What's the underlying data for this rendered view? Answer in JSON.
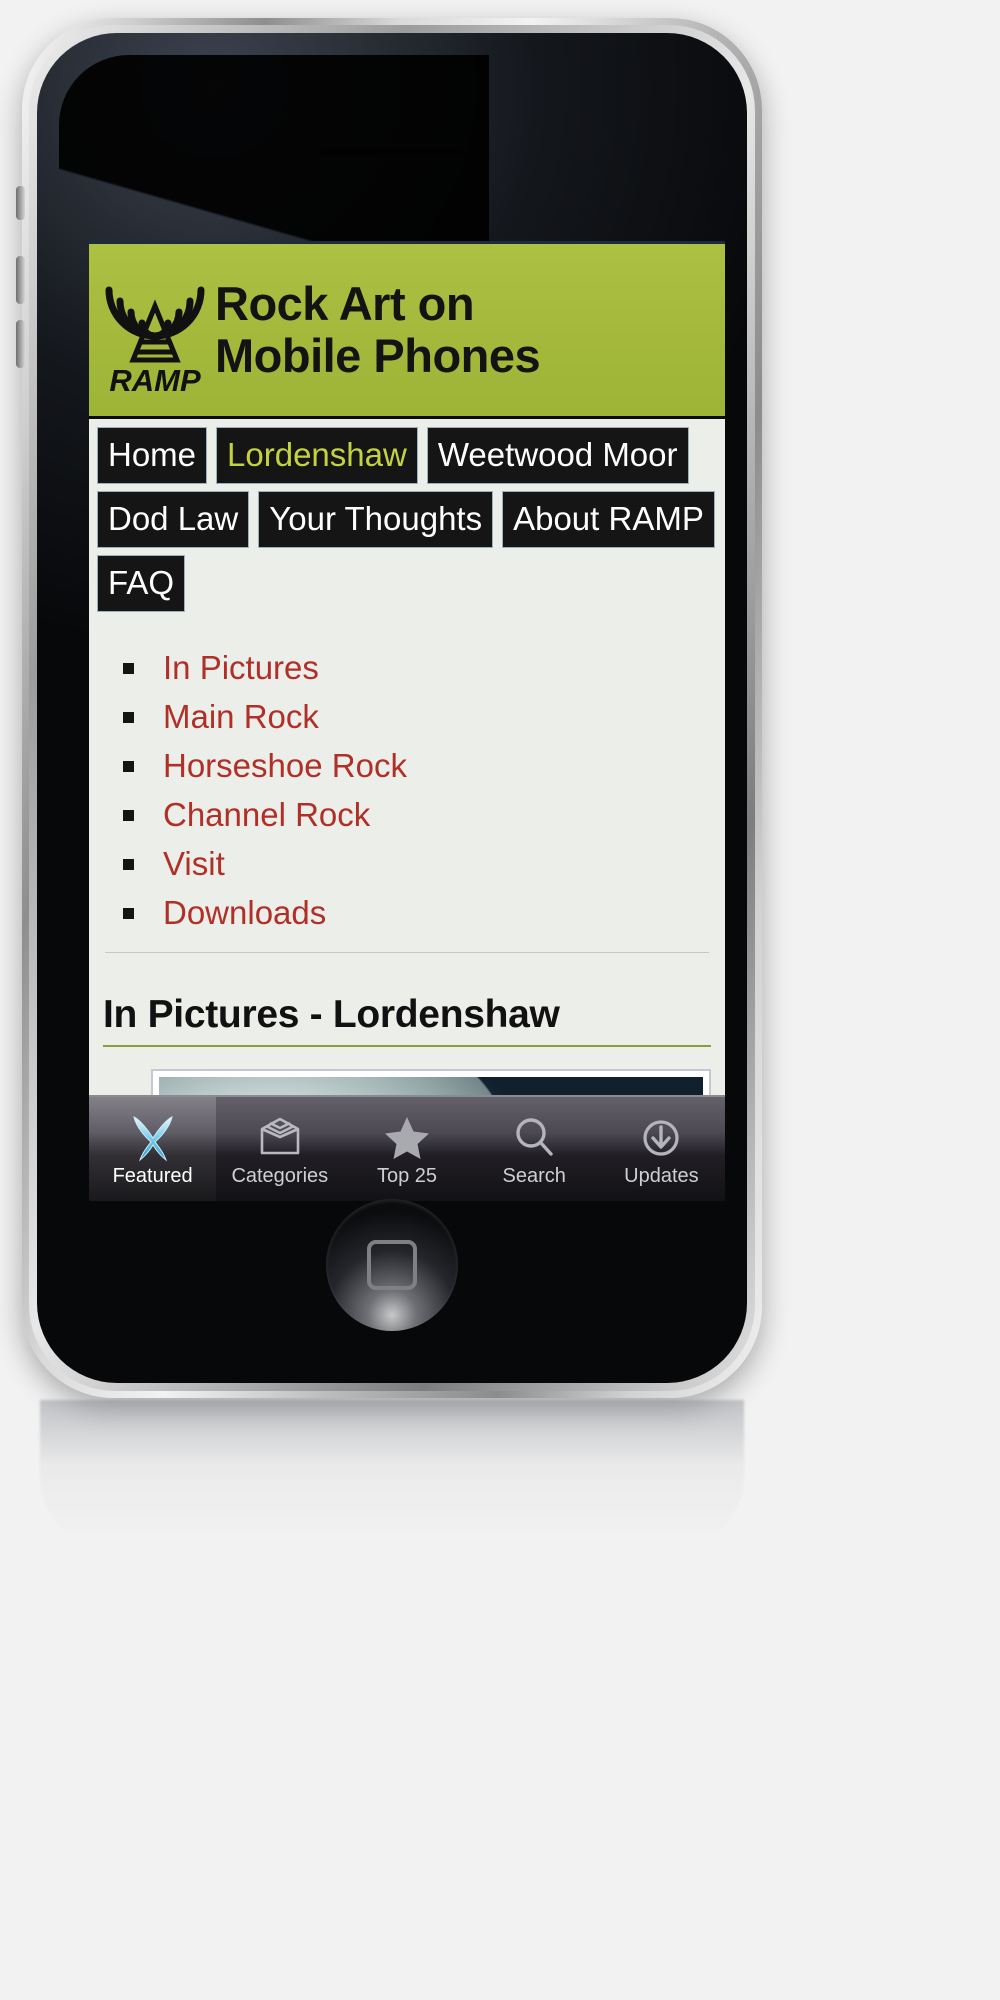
{
  "device": {
    "name": "iphone-3gs",
    "home_button": "home-button",
    "earpiece": "earpiece-speaker"
  },
  "site": {
    "header": {
      "logo_text": "RAMP",
      "logo_icon": "radio-tower-icon",
      "title_line1": "Rock Art on",
      "title_line2": "Mobile Phones",
      "background_color": "#a4b93c"
    },
    "nav": {
      "rows": [
        [
          {
            "label": "Home",
            "active": false
          },
          {
            "label": "Lordenshaw",
            "active": true
          },
          {
            "label": "Weetwood Moor",
            "active": false
          }
        ],
        [
          {
            "label": "Dod Law",
            "active": false
          },
          {
            "label": "Your Thoughts",
            "active": false
          },
          {
            "label": "About RAMP",
            "active": false
          }
        ],
        [
          {
            "label": "FAQ",
            "active": false
          }
        ]
      ],
      "active_color": "#c3d23f",
      "button_bg": "#151515"
    },
    "sublinks": [
      {
        "label": "In Pictures"
      },
      {
        "label": "Main Rock"
      },
      {
        "label": "Horseshoe Rock"
      },
      {
        "label": "Channel Rock"
      },
      {
        "label": "Visit"
      },
      {
        "label": "Downloads"
      }
    ],
    "sublink_color": "#b03028",
    "page_heading": "In Pictures - Lordenshaw",
    "heading_rule_color": "#8c9c3a",
    "photo": {
      "alt": "rock-art-photograph"
    }
  },
  "tabbar": {
    "tabs": [
      {
        "label": "Featured",
        "icon": "featured-star-x-icon",
        "selected": true
      },
      {
        "label": "Categories",
        "icon": "categories-box-icon",
        "selected": false
      },
      {
        "label": "Top 25",
        "icon": "star-icon",
        "selected": false
      },
      {
        "label": "Search",
        "icon": "search-icon",
        "selected": false
      },
      {
        "label": "Updates",
        "icon": "download-arrow-icon",
        "selected": false
      }
    ]
  }
}
